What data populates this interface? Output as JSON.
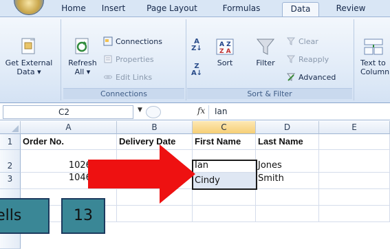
{
  "ribbon": {
    "tabs": [
      {
        "label": "Home",
        "active": false
      },
      {
        "label": "Insert",
        "active": false
      },
      {
        "label": "Page Layout",
        "active": false
      },
      {
        "label": "Formulas",
        "active": false
      },
      {
        "label": "Data",
        "active": true
      },
      {
        "label": "Review",
        "active": false
      }
    ],
    "get_external_data": {
      "line1": "Get External",
      "line2": "Data ▾"
    },
    "refresh": {
      "line1": "Refresh",
      "line2": "All ▾"
    },
    "connections": {
      "connections": "Connections",
      "properties": "Properties",
      "edit_links": "Edit Links",
      "group": "Connections"
    },
    "sort_filter": {
      "sort": "Sort",
      "filter": "Filter",
      "clear": "Clear",
      "reapply": "Reapply",
      "advanced": "Advanced",
      "group": "Sort & Filter"
    },
    "text_to_columns": {
      "line1": "Text to",
      "line2": "Column"
    }
  },
  "formula_bar": {
    "name_box": "C2",
    "fx": "fx",
    "value": "Ian"
  },
  "grid": {
    "columns": [
      "A",
      "B",
      "C",
      "D",
      "E"
    ],
    "rows": [
      "1",
      "2",
      "3"
    ],
    "cells": {
      "A1": "Order No.",
      "B1": "Delivery Date",
      "C1": "First Name",
      "D1": "Last Name",
      "A2": "10267666",
      "C2": "Ian",
      "D2": "Jones",
      "A3": "10468278",
      "C3": "Cindy",
      "D3": "Smith"
    }
  },
  "overlays": {
    "box_a": "cells",
    "box_b": "13"
  },
  "colors": {
    "arrow": "#ee1111",
    "overlay_box": "#3a8796",
    "selected_column": "#f6cf76"
  }
}
